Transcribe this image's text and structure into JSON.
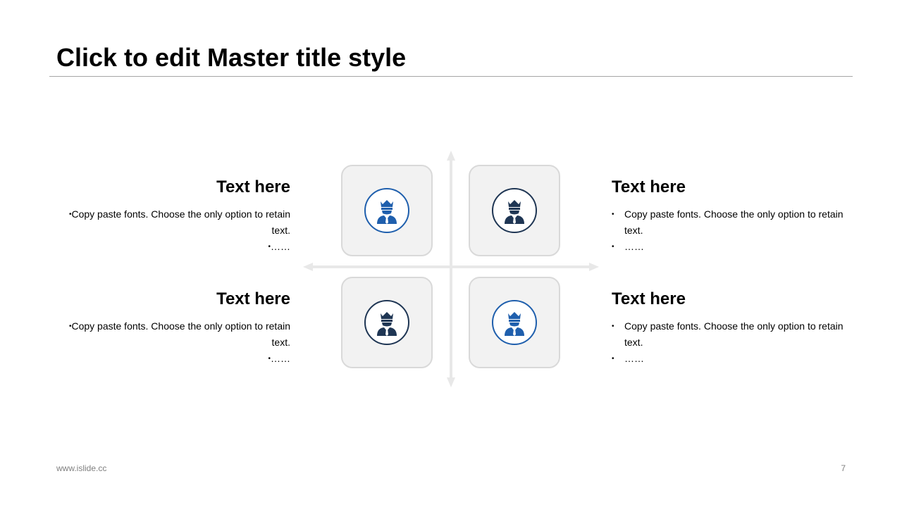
{
  "slide": {
    "title": "Click to edit Master title style"
  },
  "quadrants": [
    {
      "heading": "Text here",
      "bullets": [
        "Copy paste fonts. Choose the only option to retain text.",
        "……"
      ],
      "icon": "king-person-icon",
      "icon_color": "#1f5fad"
    },
    {
      "heading": "Text here",
      "bullets": [
        "Copy paste fonts. Choose the only option to retain text.",
        "……"
      ],
      "icon": "king-person-icon",
      "icon_color": "#1f3654"
    },
    {
      "heading": "Text here",
      "bullets": [
        "Copy paste fonts. Choose the only option to retain text.",
        "……"
      ],
      "icon": "king-person-icon",
      "icon_color": "#1f3654"
    },
    {
      "heading": "Text here",
      "bullets": [
        "Copy paste fonts. Choose the only option to retain text.",
        "……"
      ],
      "icon": "king-person-icon",
      "icon_color": "#1f5fad"
    }
  ],
  "footer": {
    "url": "www.islide.cc",
    "page_number": "7"
  }
}
